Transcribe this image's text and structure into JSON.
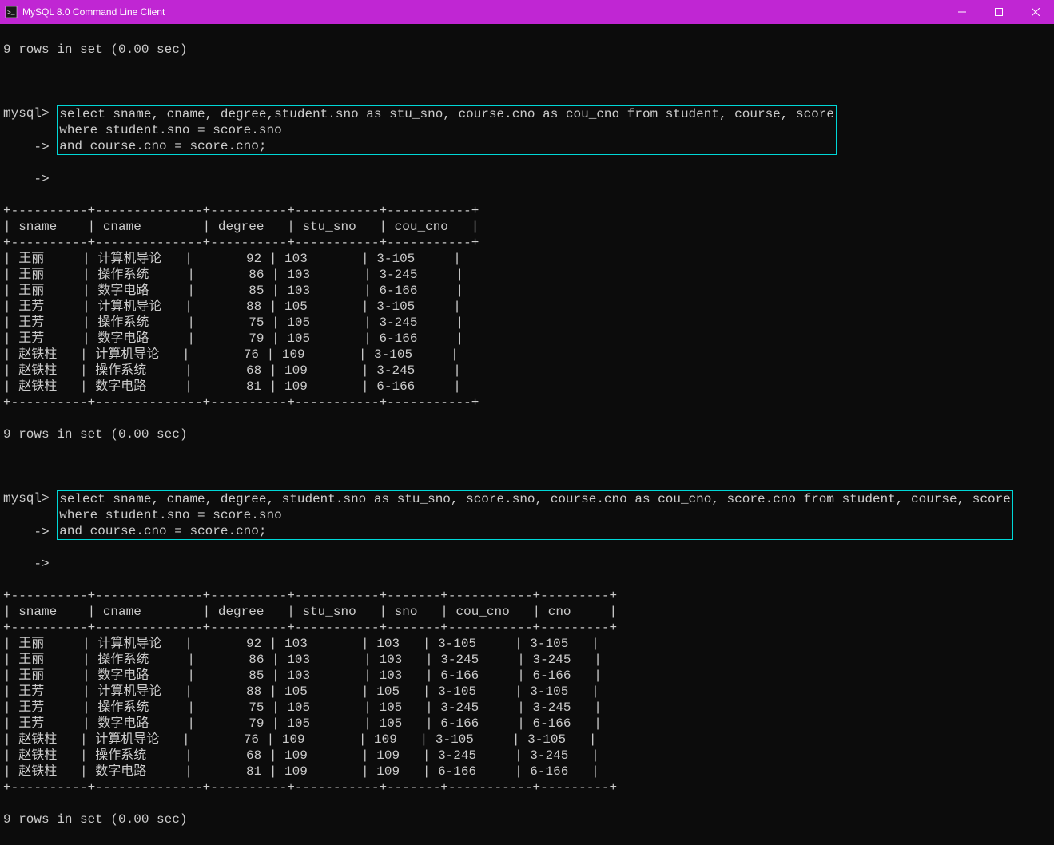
{
  "window": {
    "title": "MySQL 8.0 Command Line Client"
  },
  "top_status": "9 rows in set (0.00 sec)",
  "query1": {
    "prompt1": "mysql>",
    "prompt2": "    ->",
    "prompt3": "    ->",
    "line1": "select sname, cname, degree,student.sno as stu_sno, course.cno as cou_cno from student, course, score",
    "line2": "where student.sno = score.sno",
    "line3": "and course.cno = score.cno;"
  },
  "table1": {
    "headers": [
      "sname",
      "cname",
      "degree",
      "stu_sno",
      "cou_cno"
    ],
    "rows": [
      [
        "王丽",
        "计算机导论",
        "92",
        "103",
        "3-105"
      ],
      [
        "王丽",
        "操作系统",
        "86",
        "103",
        "3-245"
      ],
      [
        "王丽",
        "数字电路",
        "85",
        "103",
        "6-166"
      ],
      [
        "王芳",
        "计算机导论",
        "88",
        "105",
        "3-105"
      ],
      [
        "王芳",
        "操作系统",
        "75",
        "105",
        "3-245"
      ],
      [
        "王芳",
        "数字电路",
        "79",
        "105",
        "6-166"
      ],
      [
        "赵铁柱",
        "计算机导论",
        "76",
        "109",
        "3-105"
      ],
      [
        "赵铁柱",
        "操作系统",
        "68",
        "109",
        "3-245"
      ],
      [
        "赵铁柱",
        "数字电路",
        "81",
        "109",
        "6-166"
      ]
    ]
  },
  "mid_status": "9 rows in set (0.00 sec)",
  "query2": {
    "prompt1": "mysql>",
    "prompt2": "    ->",
    "prompt3": "    ->",
    "line1": "select sname, cname, degree, student.sno as stu_sno, score.sno, course.cno as cou_cno, score.cno from student, course, score",
    "line2": "where student.sno = score.sno",
    "line3": "and course.cno = score.cno;"
  },
  "table2": {
    "headers": [
      "sname",
      "cname",
      "degree",
      "stu_sno",
      "sno",
      "cou_cno",
      "cno"
    ],
    "rows": [
      [
        "王丽",
        "计算机导论",
        "92",
        "103",
        "103",
        "3-105",
        "3-105"
      ],
      [
        "王丽",
        "操作系统",
        "86",
        "103",
        "103",
        "3-245",
        "3-245"
      ],
      [
        "王丽",
        "数字电路",
        "85",
        "103",
        "103",
        "6-166",
        "6-166"
      ],
      [
        "王芳",
        "计算机导论",
        "88",
        "105",
        "105",
        "3-105",
        "3-105"
      ],
      [
        "王芳",
        "操作系统",
        "75",
        "105",
        "105",
        "3-245",
        "3-245"
      ],
      [
        "王芳",
        "数字电路",
        "79",
        "105",
        "105",
        "6-166",
        "6-166"
      ],
      [
        "赵铁柱",
        "计算机导论",
        "76",
        "109",
        "109",
        "3-105",
        "3-105"
      ],
      [
        "赵铁柱",
        "操作系统",
        "68",
        "109",
        "109",
        "3-245",
        "3-245"
      ],
      [
        "赵铁柱",
        "数字电路",
        "81",
        "109",
        "109",
        "6-166",
        "6-166"
      ]
    ]
  },
  "bottom_status": "9 rows in set (0.00 sec)"
}
